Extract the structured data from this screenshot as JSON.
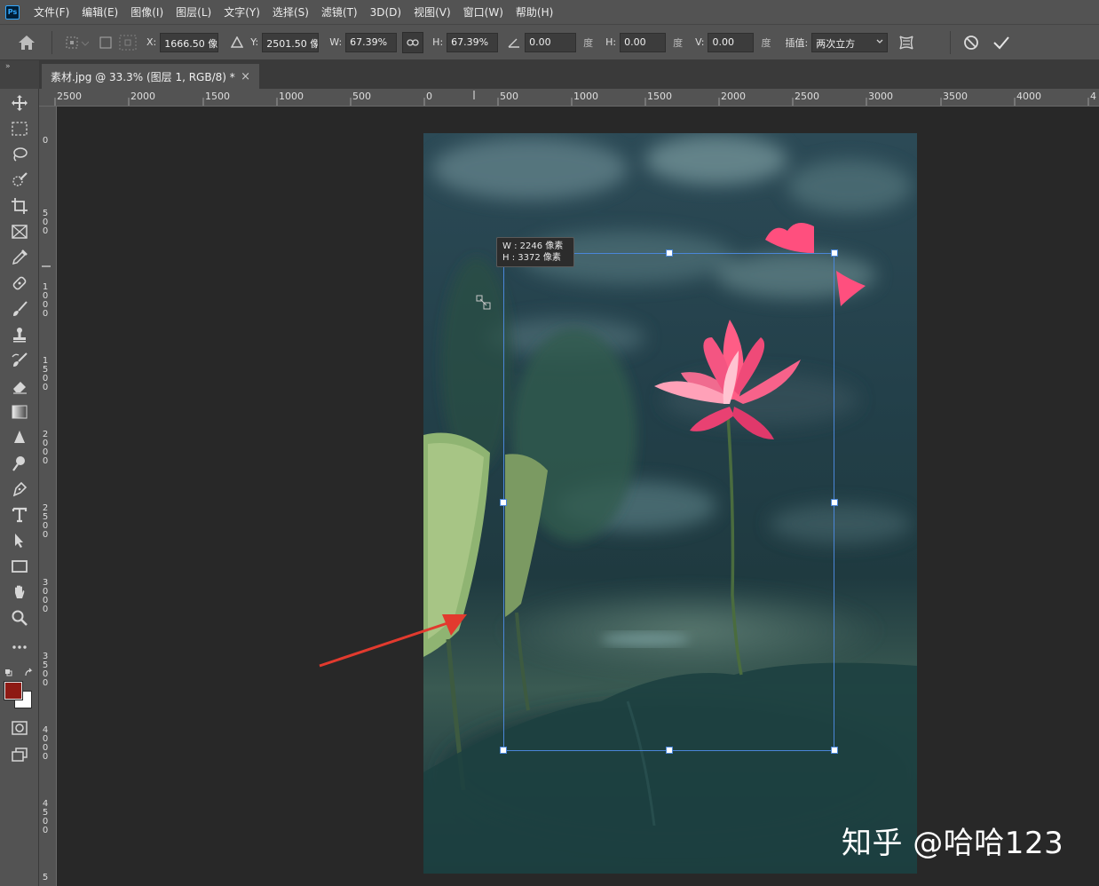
{
  "app": {
    "name": "Photoshop",
    "logo_text": "Ps"
  },
  "menu": [
    "文件(F)",
    "编辑(E)",
    "图像(I)",
    "图层(L)",
    "文字(Y)",
    "选择(S)",
    "滤镜(T)",
    "3D(D)",
    "视图(V)",
    "窗口(W)",
    "帮助(H)"
  ],
  "options": {
    "x_label": "X:",
    "x_value": "1666.50 像",
    "y_label": "Y:",
    "y_value": "2501.50 像",
    "w_label": "W:",
    "w_value": "67.39%",
    "h_label": "H:",
    "h_value": "67.39%",
    "angle_value": "0.00",
    "angle_unit": "度",
    "hskew_label": "H:",
    "hskew_value": "0.00",
    "hskew_unit": "度",
    "vskew_label": "V:",
    "vskew_value": "0.00",
    "vskew_unit": "度",
    "interp_label": "插值:",
    "interp_value": "两次立方"
  },
  "panel_collapse": "»",
  "document_tab": {
    "title": "素材.jpg @ 33.3% (图层 1, RGB/8) *",
    "close": "×"
  },
  "ruler_top_labels": [
    "2500",
    "2000",
    "1500",
    "1000",
    "500",
    "0",
    "500",
    "1000",
    "1500",
    "2000",
    "2500",
    "3000",
    "3500",
    "4000",
    "4"
  ],
  "ruler_left_labels": [
    "0",
    "500",
    "1000",
    "1500",
    "2000",
    "2500",
    "3000",
    "3500",
    "4000",
    "4500",
    "5"
  ],
  "transform_tooltip": {
    "w_line": "W : 2246 像素",
    "h_line": "H : 3372 像素"
  },
  "colors": {
    "foreground": "#8e1a14",
    "background": "#ffffff",
    "accent": "#4a86d8",
    "arrow": "#e23a2e"
  },
  "watermark": "知乎 @哈哈123"
}
